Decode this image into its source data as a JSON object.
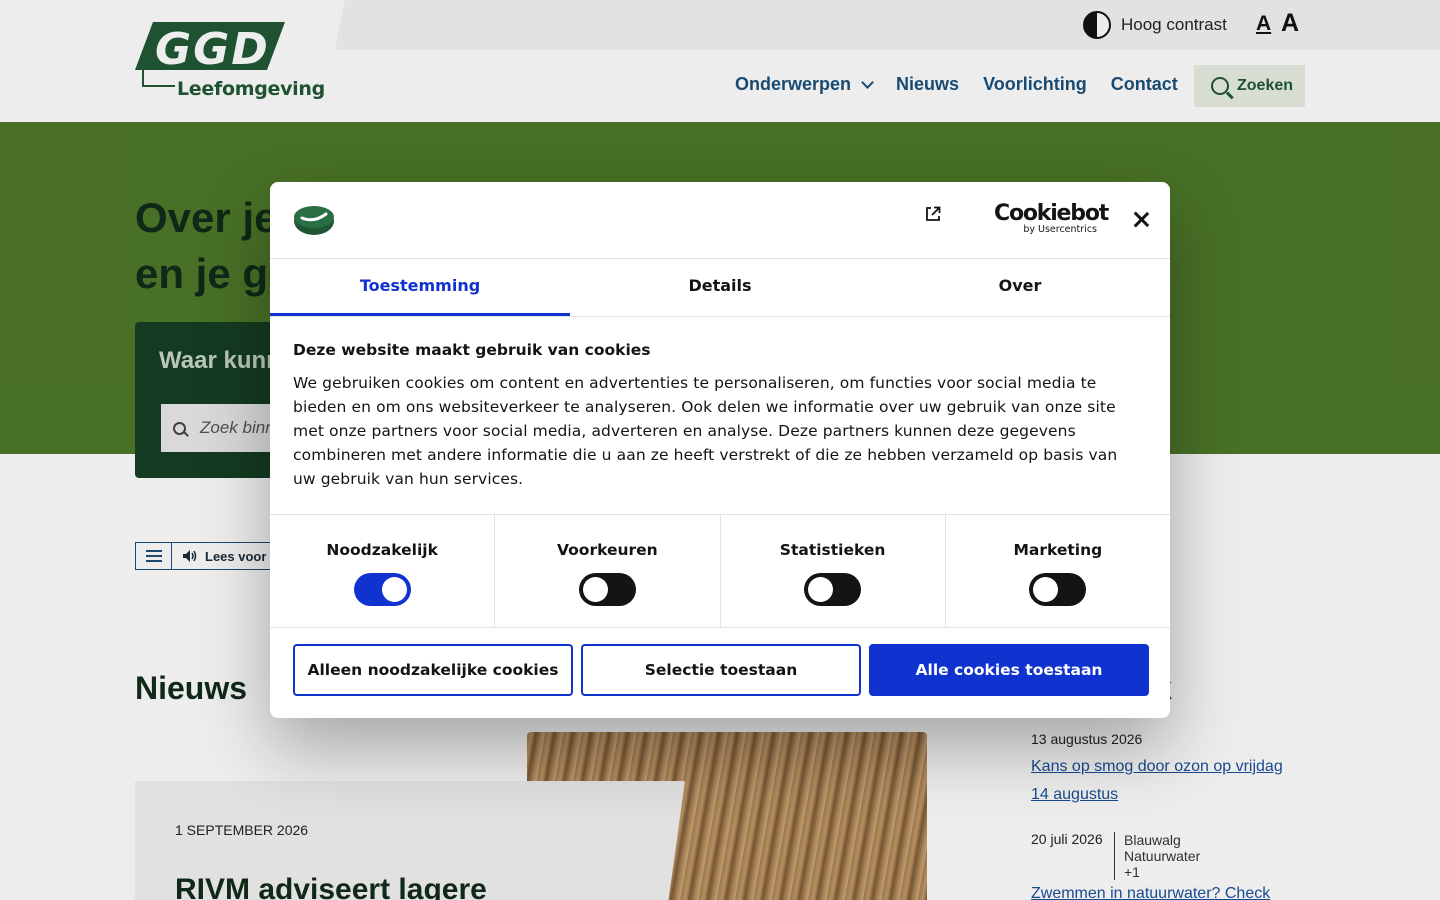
{
  "header": {
    "logo_text": "GGD",
    "logo_subtitle": "Leefomgeving",
    "contrast_label": "Hoog contrast",
    "font_small": "A",
    "font_large": "A",
    "nav": [
      "Onderwerpen",
      "Nieuws",
      "Voorlichting",
      "Contact"
    ],
    "search_label": "Zoeken"
  },
  "hero": {
    "title_line1": "Over je",
    "title_line2": "en je ge",
    "search_card_title": "Waar kunn",
    "search_placeholder": "Zoek binn"
  },
  "readspeaker": {
    "label": "Lees voor"
  },
  "news": {
    "heading": "Nieuws",
    "date": "1 SEPTEMBER 2026",
    "title": "RIVM adviseert lagere"
  },
  "right": {
    "heading": "k",
    "items": [
      {
        "date": "13 augustus 2026",
        "link": "Kans op smog door ozon op vrijdag 14 augustus"
      },
      {
        "date": "20 juli 2026",
        "tags": [
          "Blauwalg",
          "Natuurwater",
          "+1"
        ],
        "link": "Zwemmen in natuurwater? Check"
      }
    ]
  },
  "cookie_dialog": {
    "brand_main": "Cookiebot",
    "brand_sub": "by Usercentrics",
    "tabs": [
      "Toestemming",
      "Details",
      "Over"
    ],
    "active_tab": "Toestemming",
    "title": "Deze website maakt gebruik van cookies",
    "text": "We gebruiken cookies om content en advertenties te personaliseren, om functies voor social media te bieden en om ons websiteverkeer te analyseren. Ook delen we informatie over uw gebruik van onze site met onze partners voor social media, adverteren en analyse. Deze partners kunnen deze gegevens combineren met andere informatie die u aan ze heeft verstrekt of die ze hebben verzameld op basis van uw gebruik van hun services.",
    "categories": [
      {
        "label": "Noodzakelijk",
        "enabled": true
      },
      {
        "label": "Voorkeuren",
        "enabled": false
      },
      {
        "label": "Statistieken",
        "enabled": false
      },
      {
        "label": "Marketing",
        "enabled": false
      }
    ],
    "buttons": {
      "necessary": "Alleen noodzakelijke cookies",
      "selection": "Selectie toestaan",
      "all": "Alle cookies toestaan"
    }
  },
  "colors": {
    "brand_green": "#1f5734",
    "hero_green": "#4d7828",
    "nav_blue": "#1a4f7a",
    "cookie_blue": "#1032cf"
  }
}
